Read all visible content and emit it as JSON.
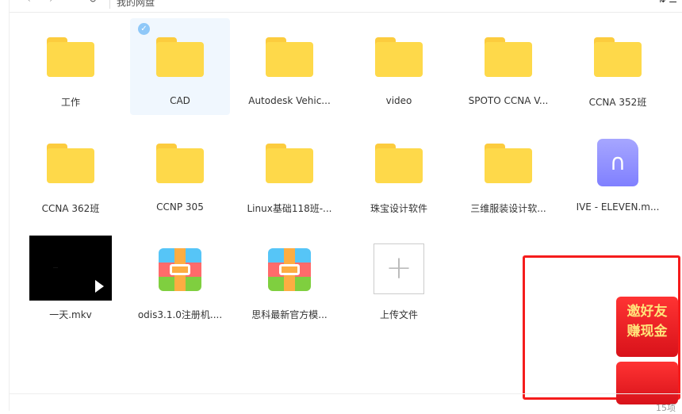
{
  "toolbar": {
    "back": "‹",
    "forward": "›",
    "refresh": "↻",
    "breadcrumb": "我的网盘",
    "tools": "⇅ ☰"
  },
  "items": [
    {
      "name": "工作",
      "type": "folder"
    },
    {
      "name": "CAD",
      "type": "folder",
      "selected": true
    },
    {
      "name": "Autodesk Vehic...",
      "type": "folder"
    },
    {
      "name": "video",
      "type": "folder"
    },
    {
      "name": "SPOTO CCNA V...",
      "type": "folder"
    },
    {
      "name": "CCNA 352班",
      "type": "folder"
    },
    {
      "name": "CCNA 362班",
      "type": "folder"
    },
    {
      "name": "CCNP 305",
      "type": "folder"
    },
    {
      "name": "Linux基础118班-...",
      "type": "folder"
    },
    {
      "name": "珠宝设计软件",
      "type": "folder"
    },
    {
      "name": "三维服装设计软...",
      "type": "folder"
    },
    {
      "name": "IVE - ELEVEN.m...",
      "type": "audio"
    },
    {
      "name": "一天.mkv",
      "type": "video"
    },
    {
      "name": "odis3.1.0注册机....",
      "type": "zip"
    },
    {
      "name": "思科最新官方模...",
      "type": "zip"
    },
    {
      "name": "上传文件",
      "type": "upload"
    }
  ],
  "promo": {
    "line1": "邀好友",
    "line2": "赚现金"
  },
  "status": {
    "count": "15项"
  },
  "colors": {
    "folder": "#fed94a",
    "selection": "#f0f7fe",
    "highlight_box": "#f51c1c"
  }
}
